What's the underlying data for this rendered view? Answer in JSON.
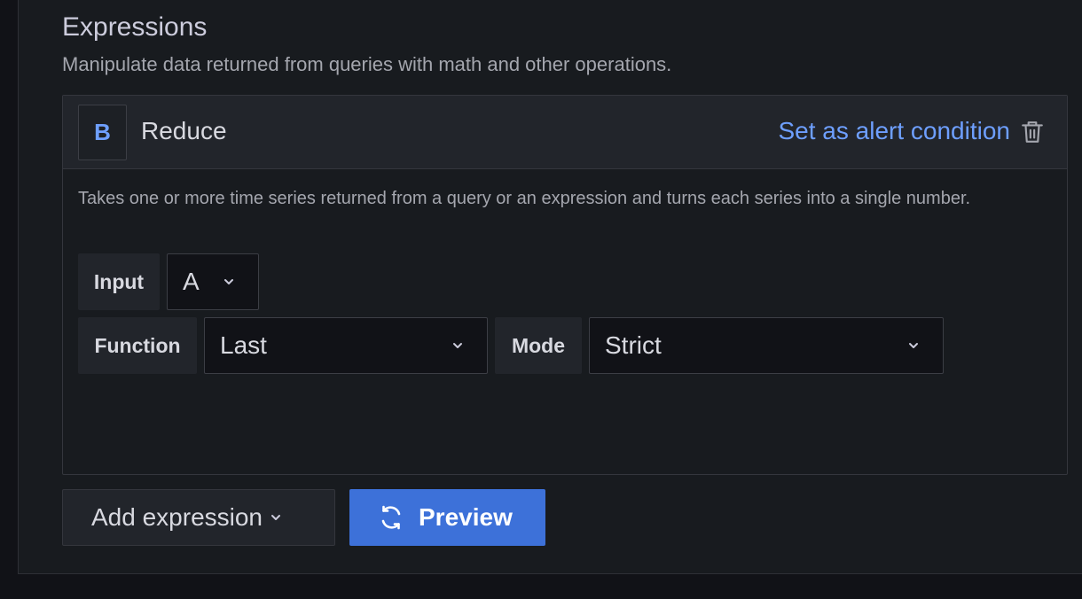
{
  "section": {
    "title": "Expressions",
    "description": "Manipulate data returned from queries with math and other operations."
  },
  "expression": {
    "ref_id": "B",
    "type": "Reduce",
    "alert_condition_link": "Set as alert condition",
    "description": "Takes one or more time series returned from a query or an expression and turns each series into a single number.",
    "input": {
      "label": "Input",
      "value": "A"
    },
    "function": {
      "label": "Function",
      "value": "Last"
    },
    "mode": {
      "label": "Mode",
      "value": "Strict"
    }
  },
  "actions": {
    "add_expression": "Add expression",
    "preview": "Preview"
  },
  "icons": {
    "delete": "trash-icon",
    "dropdown": "chevron-down-icon",
    "preview": "refresh-icon"
  },
  "colors": {
    "link": "#6e9fff",
    "primary_button": "#3d71d9",
    "background": "#181b1f",
    "header": "#22252b"
  }
}
